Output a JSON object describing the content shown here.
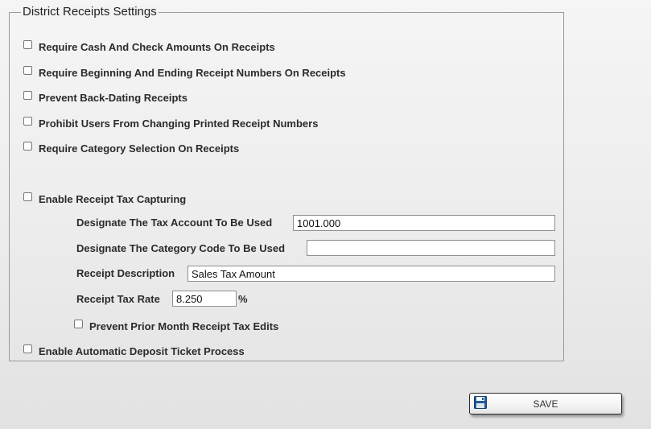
{
  "group": {
    "title": "District Receipts Settings"
  },
  "options": {
    "require_cash_check": "Require Cash And Check Amounts On Receipts",
    "require_begin_end_numbers": "Require Beginning And Ending Receipt Numbers On Receipts",
    "prevent_back_dating": "Prevent Back-Dating Receipts",
    "prohibit_changing_numbers": "Prohibit Users From Changing Printed Receipt Numbers",
    "require_category": "Require Category  Selection On Receipts",
    "enable_tax_capturing": "Enable Receipt Tax Capturing",
    "prevent_prior_month_edits": "Prevent Prior Month Receipt Tax Edits",
    "enable_deposit_ticket": "Enable Automatic Deposit Ticket Process"
  },
  "tax": {
    "account_label": "Designate The Tax Account To Be Used",
    "account_value": "1001.000",
    "category_label": "Designate The Category Code To Be Used",
    "category_value": "",
    "description_label": "Receipt Description",
    "description_value": "Sales Tax Amount",
    "rate_label": "Receipt Tax Rate",
    "rate_value": "8.250",
    "rate_unit": "%"
  },
  "actions": {
    "save_label": "SAVE",
    "save_icon": "floppy-disk-icon"
  },
  "colors": {
    "save_icon": "#1f5c99"
  }
}
